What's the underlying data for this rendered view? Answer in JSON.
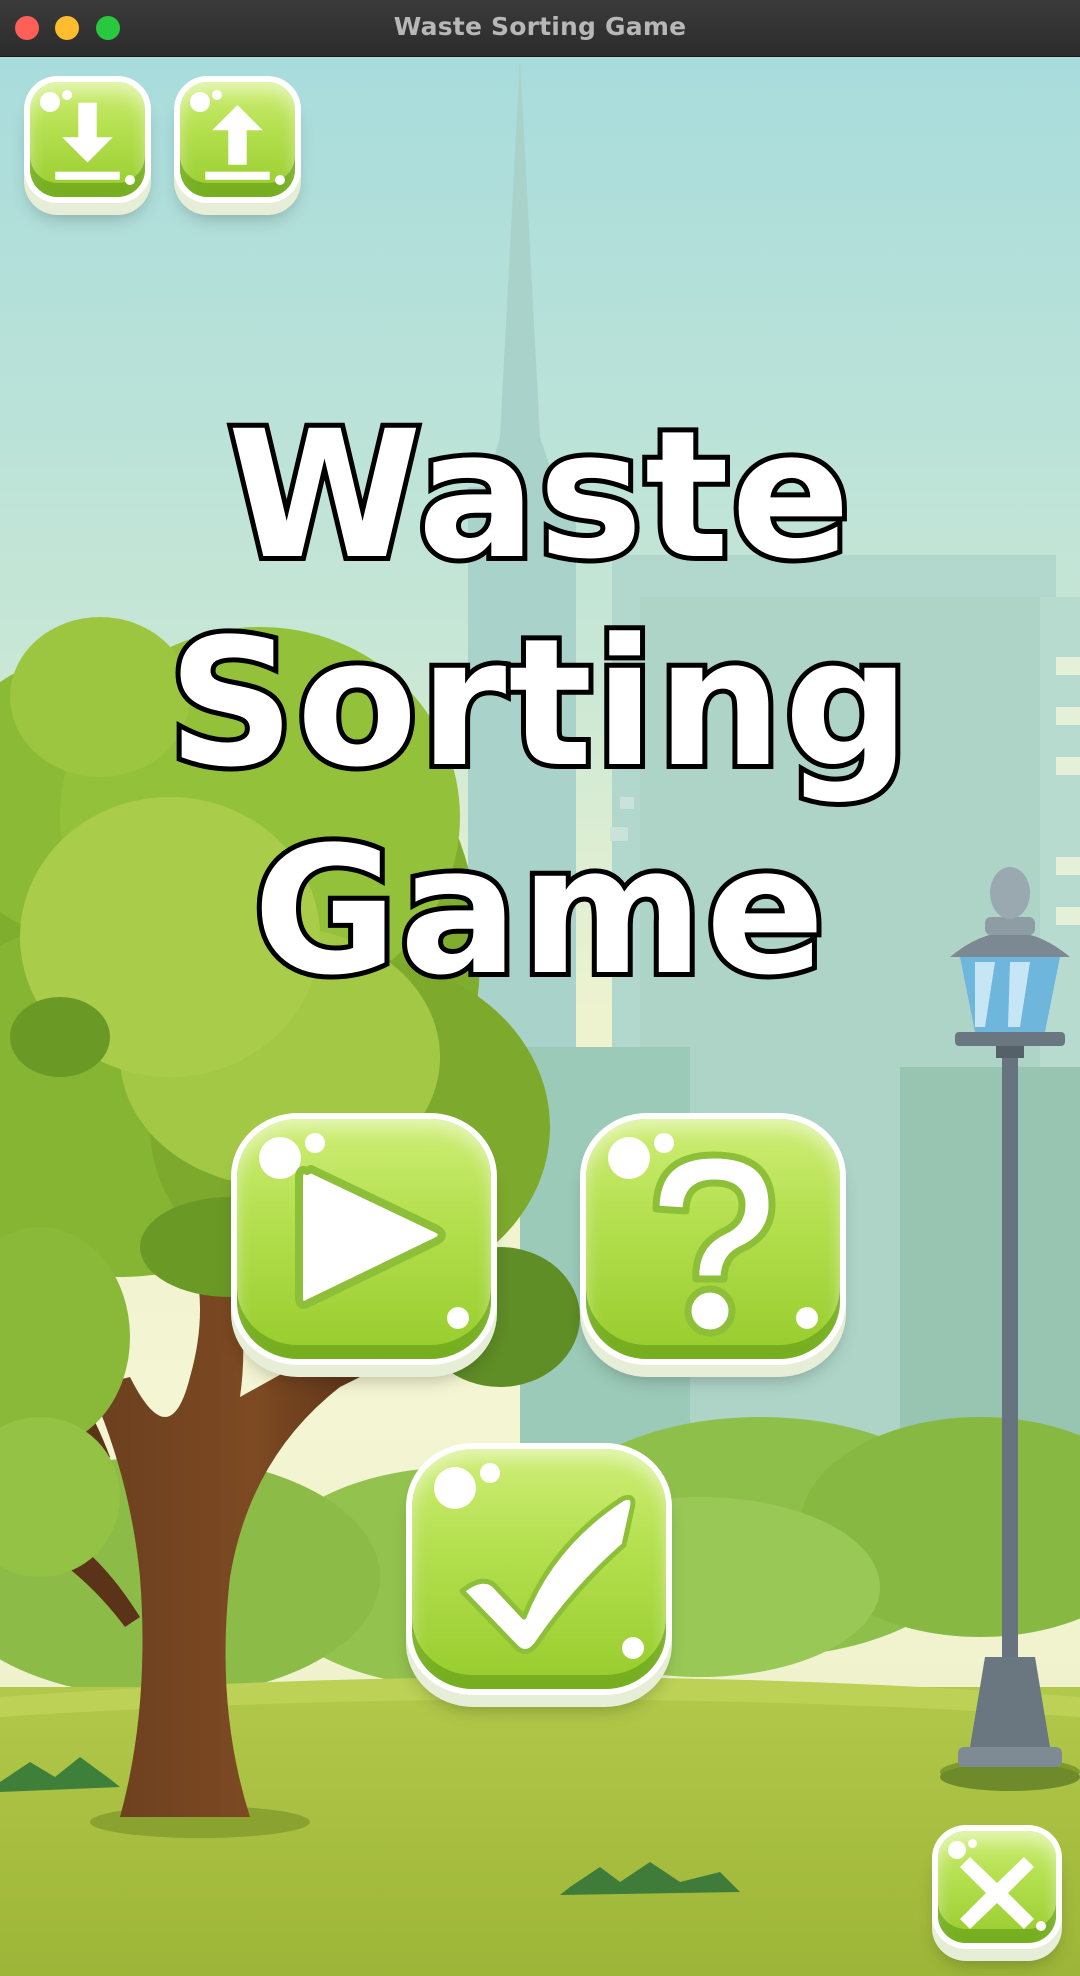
{
  "window": {
    "title": "Waste Sorting Game"
  },
  "game": {
    "title_lines": [
      "Waste",
      "Sorting",
      "Game"
    ]
  },
  "buttons": {
    "download": {
      "icon": "download-icon"
    },
    "upload": {
      "icon": "upload-icon"
    },
    "play": {
      "icon": "play-icon"
    },
    "help": {
      "icon": "question-mark-icon"
    },
    "confirm": {
      "icon": "checkmark-icon"
    },
    "close": {
      "icon": "close-icon"
    }
  },
  "colors": {
    "button_green": "#b5e050",
    "button_outline": "#ffffff",
    "title_fill": "#ffffff",
    "title_stroke": "#000000",
    "sky_top": "#a9dcdc",
    "grass": "#a7c23c"
  }
}
